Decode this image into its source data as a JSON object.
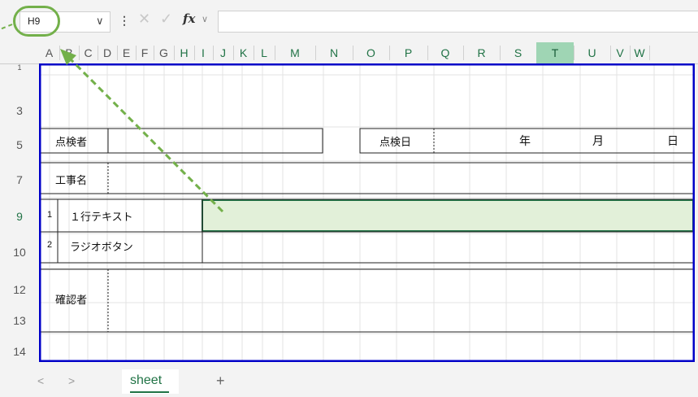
{
  "formula_bar": {
    "name_box": "H9",
    "dropdown_glyph": "∨",
    "more_glyph": "⋮",
    "cancel_glyph": "✕",
    "enter_glyph": "✓",
    "fx_label": "fx",
    "fx_dropdown_glyph": "∨",
    "formula_value": ""
  },
  "columns": [
    "A",
    "B",
    "C",
    "D",
    "E",
    "F",
    "G",
    "H",
    "I",
    "J",
    "K",
    "L",
    "M",
    "N",
    "O",
    "P",
    "Q",
    "R",
    "S",
    "T",
    "U",
    "V",
    "W"
  ],
  "rows": [
    "1",
    "3",
    "5",
    "7",
    "9",
    "10",
    "12",
    "13",
    "14"
  ],
  "cells": {
    "inspector_label": "点検者",
    "inspect_date_label": "点検日",
    "year_label": "年",
    "month_label": "月",
    "day_label": "日",
    "project_label": "工事名",
    "item1_num": "1",
    "item1_label": "１行テキスト",
    "item2_num": "2",
    "item2_label": "ラジオボタン",
    "confirmer_label": "確認者"
  },
  "tabs": {
    "prev": "<",
    "next": ">",
    "sheet_name": "sheet",
    "add": "+"
  },
  "colors": {
    "accent": "#217346",
    "selection_fill": "#e2f0d9",
    "annotation": "#73b04a",
    "print_border": "#0000c8"
  },
  "icons": [
    "dropdown-icon",
    "more-icon",
    "cancel-icon",
    "enter-icon",
    "fx-icon",
    "prev-sheet-icon",
    "next-sheet-icon",
    "add-sheet-icon"
  ]
}
